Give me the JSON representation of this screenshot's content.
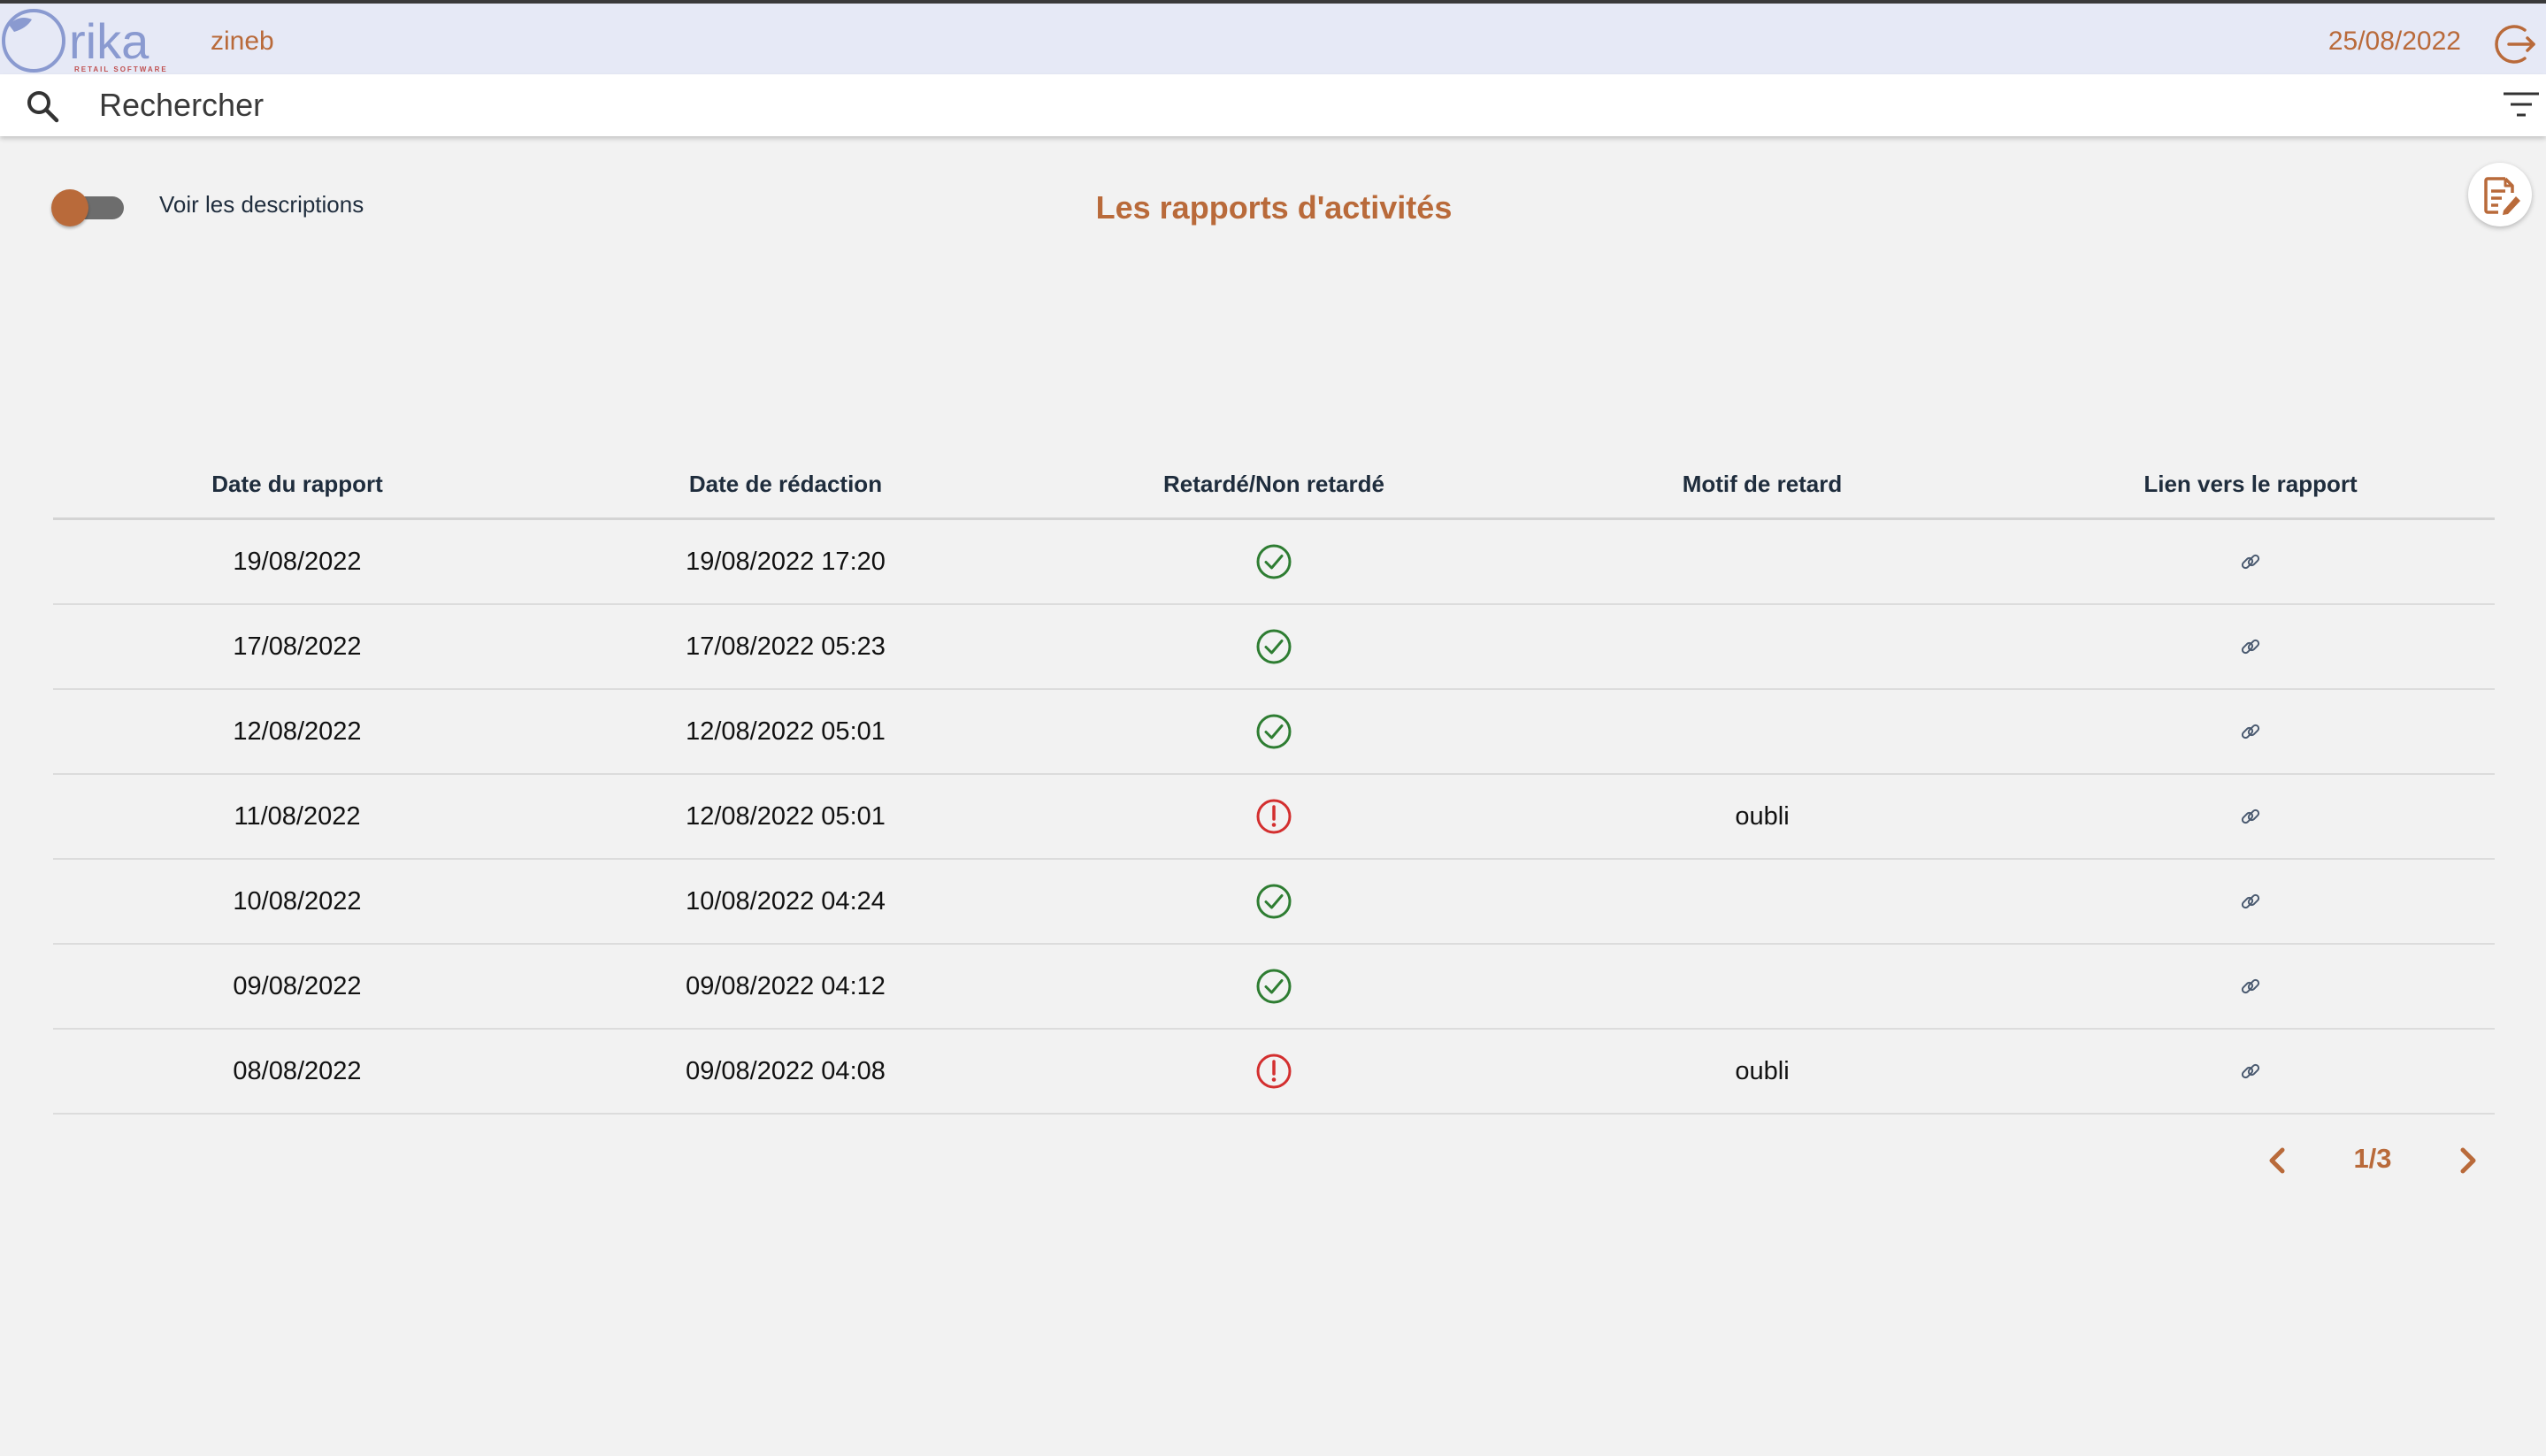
{
  "header": {
    "logo_text": "rika",
    "logo_tagline": "RETAIL SOFTWARE",
    "username": "zineb",
    "date": "25/08/2022"
  },
  "search": {
    "placeholder": "Rechercher",
    "value": ""
  },
  "controls": {
    "toggle_label": "Voir les descriptions",
    "toggle_on": false,
    "page_title": "Les rapports d'activités"
  },
  "table": {
    "columns": [
      "Date du rapport",
      "Date de rédaction",
      "Retardé/Non retardé",
      "Motif de retard",
      "Lien vers le rapport"
    ],
    "rows": [
      {
        "date_rapport": "19/08/2022",
        "date_redaction": "19/08/2022 17:20",
        "status": "on-time",
        "motif": ""
      },
      {
        "date_rapport": "17/08/2022",
        "date_redaction": "17/08/2022 05:23",
        "status": "on-time",
        "motif": ""
      },
      {
        "date_rapport": "12/08/2022",
        "date_redaction": "12/08/2022 05:01",
        "status": "on-time",
        "motif": ""
      },
      {
        "date_rapport": "11/08/2022",
        "date_redaction": "12/08/2022 05:01",
        "status": "late",
        "motif": "oubli"
      },
      {
        "date_rapport": "10/08/2022",
        "date_redaction": "10/08/2022 04:24",
        "status": "on-time",
        "motif": ""
      },
      {
        "date_rapport": "09/08/2022",
        "date_redaction": "09/08/2022 04:12",
        "status": "on-time",
        "motif": ""
      },
      {
        "date_rapport": "08/08/2022",
        "date_redaction": "09/08/2022 04:08",
        "status": "late",
        "motif": "oubli"
      }
    ]
  },
  "pagination": {
    "label": "1/3"
  },
  "icons": {
    "on_time": "check-circle-icon",
    "late": "alert-circle-icon",
    "link": "link-icon",
    "search": "search-icon",
    "filter": "filter-icon",
    "logout": "logout-icon",
    "report": "edit-document-icon"
  },
  "colors": {
    "accent": "#b96a3a",
    "header_bg": "#e6e9f6",
    "on_time": "#2e7d32",
    "late": "#d32f2f",
    "logo": "#8a9ad0"
  }
}
